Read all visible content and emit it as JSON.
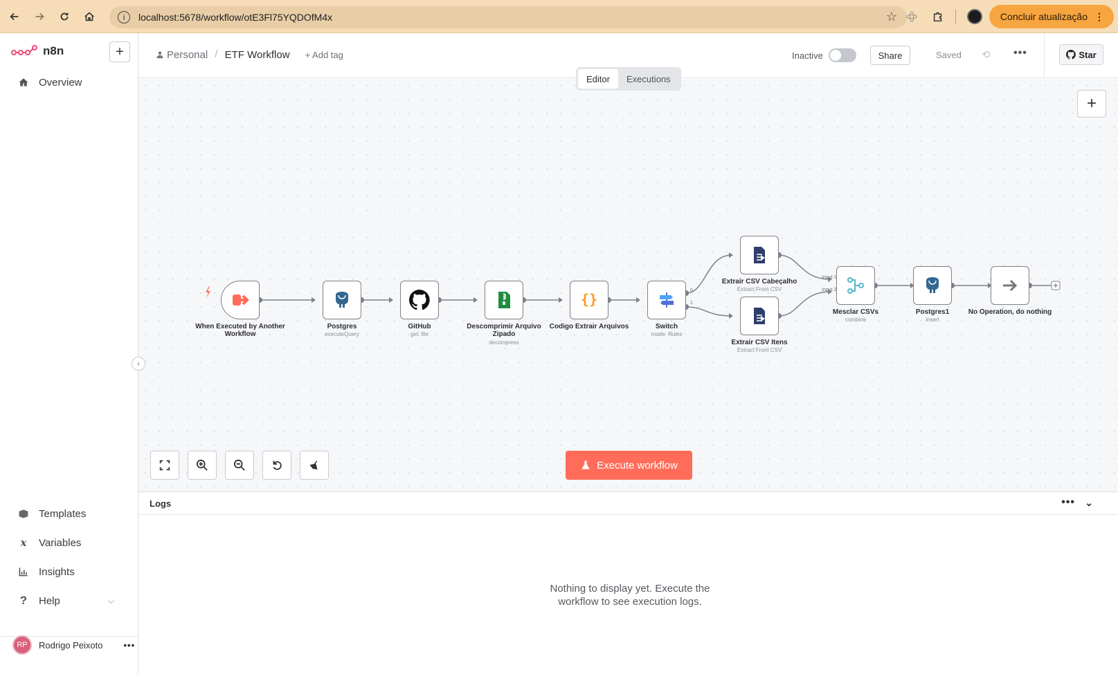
{
  "browser": {
    "url": "localhost:5678/workflow/otE3Fl75YQDOfM4x",
    "update_label": "Concluir atualização"
  },
  "sidebar": {
    "brand": "n8n",
    "items_top": [
      {
        "label": "Overview",
        "icon": "home-icon"
      }
    ],
    "items_bottom": [
      {
        "label": "Templates",
        "icon": "box-icon"
      },
      {
        "label": "Variables",
        "icon": "variable-icon"
      },
      {
        "label": "Insights",
        "icon": "chart-icon"
      },
      {
        "label": "Help",
        "icon": "question-icon"
      }
    ],
    "user": {
      "initials": "RP",
      "name": "Rodrigo Peixoto"
    }
  },
  "header": {
    "project": "Personal",
    "workflow_name": "ETF Workflow",
    "add_tag": "+ Add tag",
    "status_label": "Inactive",
    "active": false,
    "share_label": "Share",
    "saved_label": "Saved",
    "star_label": "Star"
  },
  "tabs": [
    {
      "label": "Editor",
      "active": true
    },
    {
      "label": "Executions",
      "active": false
    }
  ],
  "workflow": {
    "nodes": [
      {
        "name": "When Executed by Another Workflow",
        "sub": ""
      },
      {
        "name": "Postgres",
        "sub": "executeQuery"
      },
      {
        "name": "GitHub",
        "sub": "get: file"
      },
      {
        "name": "Descomprimir Arquivo Zipado",
        "sub": "decompress"
      },
      {
        "name": "Codigo Extrair Arquivos",
        "sub": ""
      },
      {
        "name": "Switch",
        "sub": "mode: Rules"
      },
      {
        "name": "Extrair CSV Cabeçalho",
        "sub": "Extract From CSV"
      },
      {
        "name": "Extrair CSV Itens",
        "sub": "Extract From CSV"
      },
      {
        "name": "Mesclar CSVs",
        "sub": "combine"
      },
      {
        "name": "Postgres1",
        "sub": "insert"
      },
      {
        "name": "No Operation, do nothing",
        "sub": ""
      }
    ],
    "switch_outputs": [
      "0",
      "1"
    ],
    "merge_inputs": [
      "Input 1",
      "Input 2"
    ]
  },
  "execute_label": "Execute workflow",
  "logs": {
    "title": "Logs",
    "empty_message": "Nothing to display yet. Execute the workflow to see execution logs."
  }
}
